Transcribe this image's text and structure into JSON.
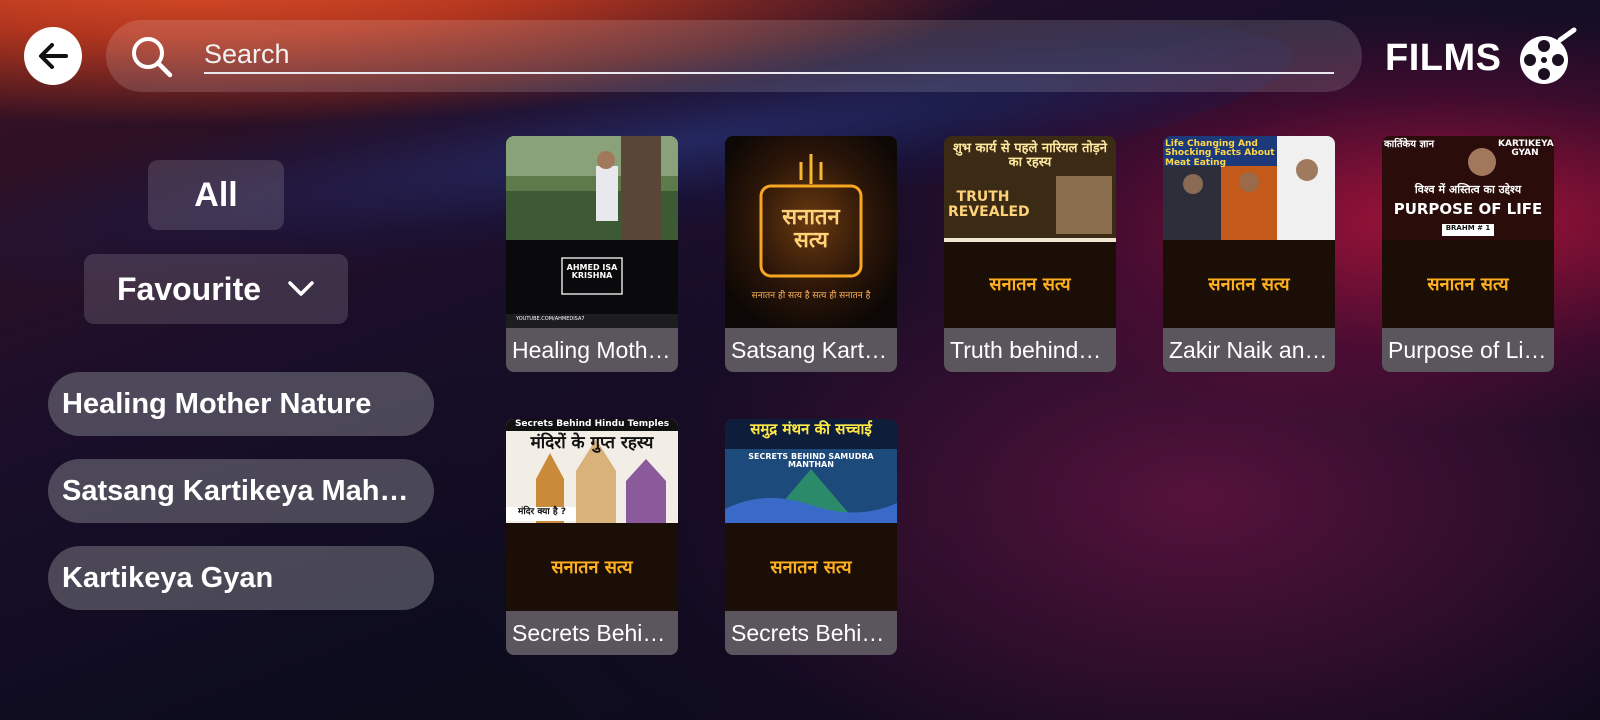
{
  "header": {
    "search_placeholder": "Search",
    "title": "FILMS",
    "back_icon": "arrow-left-icon",
    "search_icon": "search-icon",
    "films_icon": "film-reel-icon"
  },
  "filters": {
    "all_label": "All",
    "favourite_label": "Favourite"
  },
  "playlists": [
    {
      "label": "Healing Mother Nature"
    },
    {
      "label": "Satsang Kartikeya Maha…"
    },
    {
      "label": "Kartikeya Gyan"
    }
  ],
  "videos": [
    {
      "title": "Healing Moth…",
      "thumb_text": "AHMED ISA KRISHNA",
      "footer": "YOUTUBE.COM/AHMEDISA7"
    },
    {
      "title": "Satsang Karti…",
      "thumb_text": "सनातन सत्य",
      "subtitle": "सनातन ही सत्य है सत्य ही सनातन है"
    },
    {
      "title": "Truth behind…",
      "thumb_text": "शुभ कार्य से पहले नारियल तोड़ने का रहस्य",
      "badge": "TRUTH REVEALED",
      "brand": "सनातन सत्य"
    },
    {
      "title": "Zakir Naik an…",
      "thumb_text": "Life Changing And Shocking Facts About Meat Eating",
      "brand": "सनातन सत्य"
    },
    {
      "title": "Purpose of Li…",
      "thumb_text": "कार्तिकेय ज्ञान",
      "badge": "PURPOSE OF LIFE",
      "corner": "KARTIKEYA GYAN",
      "line": "विश्व में अस्तित्व का उद्देश्य",
      "tag": "BRAHM # 1",
      "brand": "सनातन सत्य"
    },
    {
      "title": "Secrets Behi…",
      "thumb_text": "Secrets Behind Hindu Temples",
      "line": "मंदिरों के गुप्त रहस्य",
      "tag": "मंदिर क्या है ?",
      "brand": "सनातन सत्य"
    },
    {
      "title": "Secrets Behi…",
      "thumb_text": "समुद्र मंथन की सच्चाई",
      "line": "SECRETS BEHIND SAMUDRA MANTHAN",
      "brand": "सनातन सत्य"
    }
  ],
  "colors": {
    "accent_orange": "#f5a623",
    "chip_bg": "rgba(255,255,255,0.14)",
    "caption_bg": "#6e6973"
  }
}
